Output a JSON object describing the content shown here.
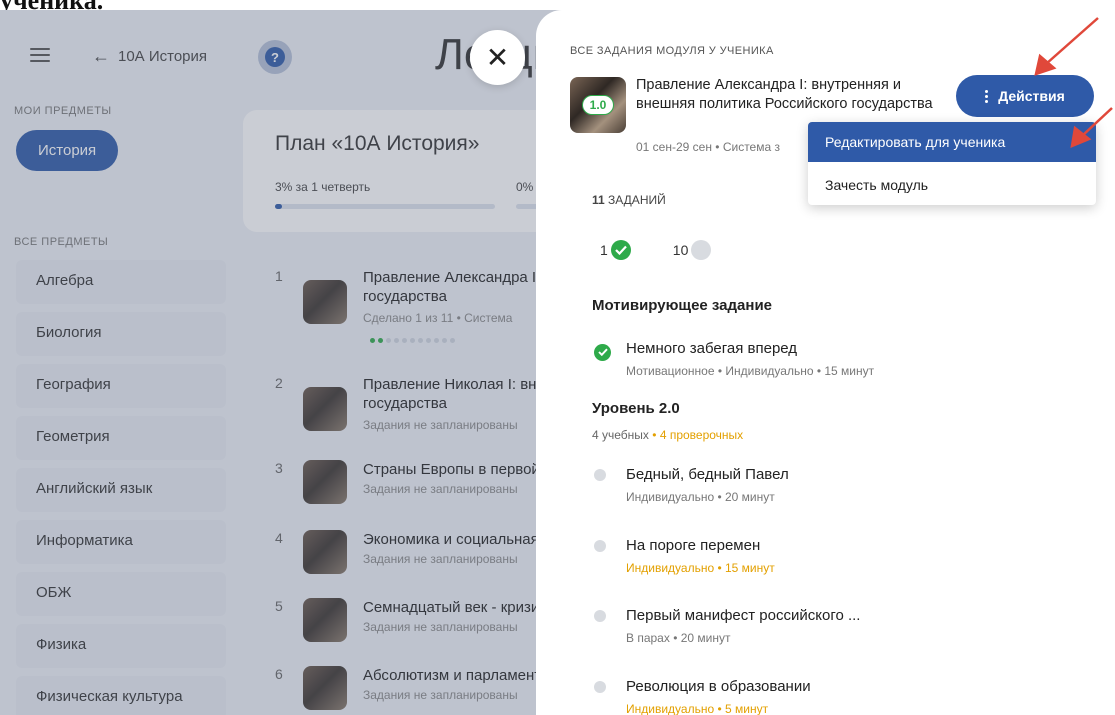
{
  "caption": {
    "text": "ученика."
  },
  "background": {
    "back_label": "10А История",
    "help_label": "?",
    "big_title": "Лекция",
    "my_subjects_label": "МОИ ПРЕДМЕТЫ",
    "current_subject": "История",
    "all_subjects_label": "ВСЕ ПРЕДМЕТЫ",
    "subjects": [
      "Алгебра",
      "Биология",
      "География",
      "Геометрия",
      "Английский язык",
      "Информатика",
      "ОБЖ",
      "Физика",
      "Физическая культура"
    ],
    "plan": {
      "title": "План «10А История»",
      "progress_label": "3% за 1 четверть",
      "progress_label_2": "0%",
      "progress_fraction": 0.03
    },
    "lessons": [
      {
        "num": "1",
        "title": "Правление Александра I: внутренняя и внешняя политика",
        "title2": "государства",
        "sub": "Сделано 1 из 11 • Система"
      },
      {
        "num": "2",
        "title": "Правление Николая I: внутренняя",
        "title2": "государства",
        "sub": "Задания не запланированы"
      },
      {
        "num": "3",
        "title": "Страны Европы в первой половине",
        "title2": "",
        "sub": "Задания не запланированы"
      },
      {
        "num": "4",
        "title": "Экономика и социальная",
        "title2": "",
        "sub": "Задания не запланированы"
      },
      {
        "num": "5",
        "title": "Семнадцатый век - кризис",
        "title2": "",
        "sub": "Задания не запланированы"
      },
      {
        "num": "6",
        "title": "Абсолютизм и парламентаризм",
        "title2": "",
        "sub": "Задания не запланированы"
      }
    ]
  },
  "drawer": {
    "label": "ВСЕ ЗАДАНИЯ МОДУЛЯ У УЧЕНИКА",
    "score": "1.0",
    "module_title": "Правление Александра I: внутренняя и внешняя политика Российского государства",
    "module_meta": "01 сен-29 сен • Система з",
    "actions_label": "Действия",
    "tasks_count_num": "11",
    "tasks_count_label": "ЗАДАНИЙ",
    "done_count": "1",
    "todo_count": "10",
    "sections": {
      "motivating": "Мотивирующее задание",
      "level": "Уровень 2.0"
    },
    "level_meta_a": "4 учебных",
    "level_meta_b": "• 4 проверочных",
    "tasks": [
      {
        "name": "Немного забегая вперед",
        "meta": "Мотивационное • Индивидуально • 15 минут",
        "done": true,
        "highlight": false
      },
      {
        "name": "Бедный, бедный Павел",
        "meta": "Индивидуально • 20 минут",
        "done": false,
        "highlight": false
      },
      {
        "name": "На пороге перемен",
        "meta": "Индивидуально • 15 минут",
        "done": false,
        "highlight": true
      },
      {
        "name": "Первый манифест российского ...",
        "meta": "В парах • 20 минут",
        "done": false,
        "highlight": false
      },
      {
        "name": "Революция в образовании",
        "meta": "Индивидуально • 5 минут",
        "done": false,
        "highlight": true
      }
    ]
  },
  "dropdown": {
    "items": [
      "Редактировать для ученика",
      "Зачесть модуль"
    ]
  },
  "colors": {
    "accent": "#2f5aa8",
    "success": "#2eaa4a",
    "warning": "#e3a000",
    "arrow": "#e0483a"
  }
}
